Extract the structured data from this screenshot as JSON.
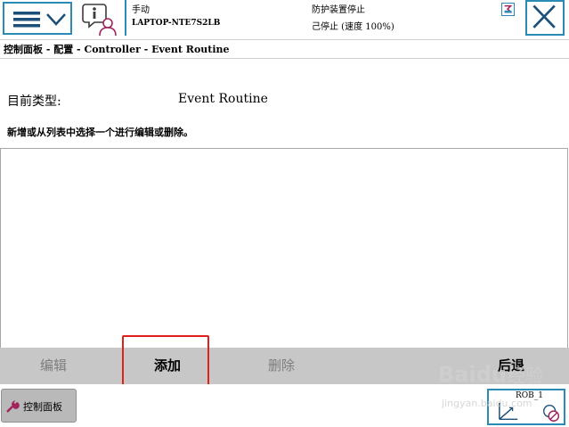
{
  "header": {
    "mode": "手动",
    "controller_name": "LAPTOP-NTE7S2LB",
    "safety_status": "防护装置停止",
    "run_status": "己停止 (速度 100%)"
  },
  "breadcrumb": "控制面板 - 配置 - Controller - Event Routine",
  "type_row": {
    "label": "目前类型:",
    "value": "Event Routine"
  },
  "instruction": "新增或从列表中选择一个进行编辑或删除。",
  "commands": {
    "edit": "编辑",
    "add": "添加",
    "delete": "删除",
    "back": "后退"
  },
  "taskbar": {
    "control_panel": "控制面板",
    "robot_unit": "ROB_1"
  },
  "colors": {
    "accent_blue": "#2c8bb4",
    "command_bar": "#c7c7c7",
    "highlight_red": "#e0201a"
  },
  "icons": [
    "menu-icon",
    "chevron-down-icon",
    "info-user-icon",
    "status-indicator-icon",
    "close-icon",
    "wrench-icon",
    "robot-axes-icon",
    "jog-disabled-icon"
  ],
  "watermark": "Baidu 经验 jingyan.baidu.com"
}
